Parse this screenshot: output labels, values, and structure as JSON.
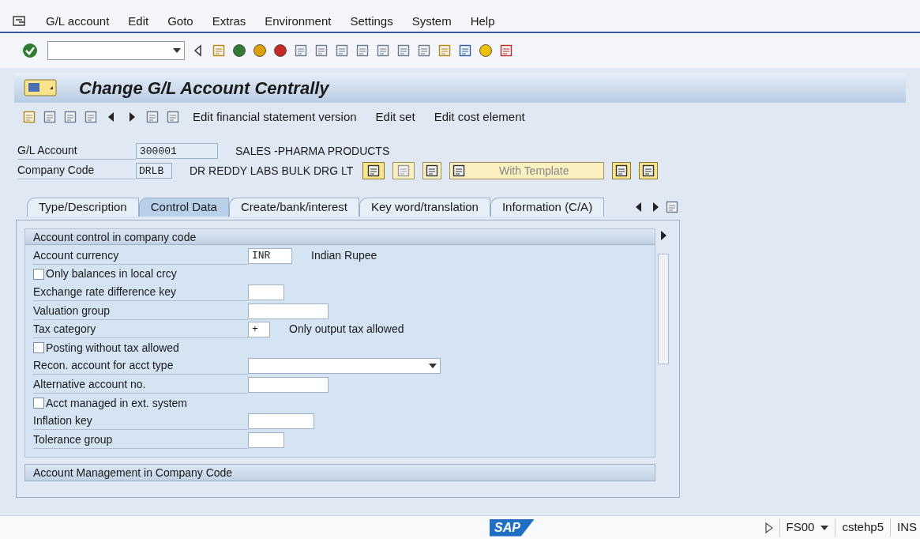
{
  "menu": [
    "G/L account",
    "Edit",
    "Goto",
    "Extras",
    "Environment",
    "Settings",
    "System",
    "Help"
  ],
  "title": "Change G/L Account Centrally",
  "app_toolbar": [
    "Edit financial statement version",
    "Edit set",
    "Edit cost element"
  ],
  "header": {
    "gl_account_label": "G/L Account",
    "gl_account": "300001",
    "gl_account_text": "SALES -PHARMA PRODUCTS",
    "company_code_label": "Company Code",
    "company_code": "DRLB",
    "company_code_text": "DR REDDY LABS BULK DRG LT",
    "template_button": "With Template"
  },
  "tabs": [
    {
      "label": "Type/Description",
      "selected": false
    },
    {
      "label": "Control Data",
      "selected": true
    },
    {
      "label": "Create/bank/interest",
      "selected": false
    },
    {
      "label": "Key word/translation",
      "selected": false
    },
    {
      "label": "Information (C/A)",
      "selected": false
    }
  ],
  "section": {
    "title": "Account control in company code",
    "rows": [
      {
        "kind": "field",
        "label": "Account currency",
        "value": "INR",
        "text": "Indian Rupee"
      },
      {
        "kind": "checkbox",
        "label": "Only balances in local crcy",
        "checked": false
      },
      {
        "kind": "field",
        "label": "Exchange rate difference key"
      },
      {
        "kind": "field",
        "label": "Valuation group"
      },
      {
        "kind": "field",
        "label": "Tax category",
        "value": "+",
        "text": "Only output tax allowed"
      },
      {
        "kind": "checkbox",
        "label": "Posting without tax allowed",
        "checked": false
      },
      {
        "kind": "dropdown",
        "label": "Recon. account for acct type"
      },
      {
        "kind": "field",
        "label": "Alternative account no."
      },
      {
        "kind": "checkbox",
        "label": "Acct managed in ext. system",
        "checked": false
      },
      {
        "kind": "field",
        "label": "Inflation key"
      },
      {
        "kind": "field",
        "label": "Tolerance group"
      }
    ]
  },
  "section2": {
    "title": "Account Management in Company Code"
  },
  "status_bar": {
    "logo": "SAP",
    "transaction": "FS00",
    "server": "cstehp5",
    "mode": "INS"
  }
}
